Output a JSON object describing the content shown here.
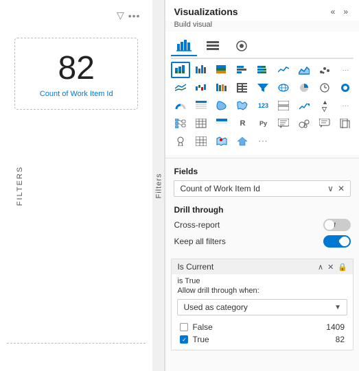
{
  "leftPanel": {
    "filterIcon": "▽",
    "dotsLabel": "•••",
    "cardNumber": "82",
    "cardLabel": "Count of Work Item Id",
    "filtersLabel": "Filters"
  },
  "rightPanel": {
    "title": "Visualizations",
    "buildVisualLabel": "Build visual",
    "tabs": [
      {
        "id": "bar-chart",
        "label": "■",
        "active": true
      },
      {
        "id": "fields",
        "label": "≡"
      },
      {
        "id": "format",
        "label": "◎"
      }
    ],
    "iconRows": [
      [
        "▦",
        "▥",
        "▤",
        "▣",
        "▢",
        "╱╲",
        "▲",
        "◫",
        "▨"
      ],
      [
        "∿",
        "▧",
        "▦",
        "▥",
        "▤",
        "⊟",
        "⊠",
        "◷",
        "◑"
      ],
      [
        "◉",
        "⊞",
        "⊡",
        "∿",
        "⊗",
        "123",
        "▦",
        "△",
        "≡"
      ],
      [
        "▦",
        "⊞",
        "⊟",
        "R",
        "Py",
        "⊕",
        "⊗",
        "▦",
        "☰"
      ],
      [
        "▦",
        "🏆",
        "⊞",
        "🗺",
        "⊕",
        "»",
        "",
        "",
        ""
      ]
    ],
    "fields": {
      "label": "Fields",
      "items": [
        {
          "name": "Count of Work Item Id"
        }
      ]
    },
    "drillThrough": {
      "label": "Drill through",
      "crossReport": {
        "label": "Cross-report",
        "state": "Off"
      },
      "keepAllFilters": {
        "label": "Keep all filters",
        "state": "On"
      }
    },
    "isCurrent": {
      "title": "Is Current",
      "isTrue": "is True",
      "allowDrillText": "Allow drill through when:",
      "dropdown": "Used as category",
      "rows": [
        {
          "label": "False",
          "value": "1409",
          "checked": false
        },
        {
          "label": "True",
          "value": "82",
          "checked": true
        }
      ]
    }
  }
}
